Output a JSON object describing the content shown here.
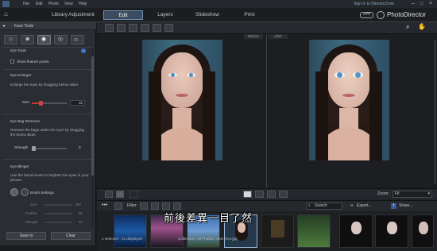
{
  "menu": {
    "file": "File",
    "edit": "Edit",
    "photo": "Photo",
    "view": "View",
    "help": "Help",
    "signin": "Sign in to DirectorZone",
    "window_icons": [
      "minimize-icon",
      "restore-icon",
      "close-icon"
    ]
  },
  "modules": {
    "library": "Library",
    "adjustment": "Adjustment",
    "edit": "Edit",
    "layers": "Layers",
    "slideshow": "Slideshow",
    "print": "Print"
  },
  "brand": {
    "app_badge": "APP",
    "name": "PhotoDirector",
    "accent": "#6d8fb0"
  },
  "panel": {
    "title": "Face Tools",
    "section_eye_tools": "Eye Tools",
    "show_feature_points": "Show feature points",
    "eye_enlarger": {
      "title": "Eye Enlarger",
      "desc": "Enlarge the eyes by dragging below slider.",
      "size_label": "Size",
      "size_value": "25"
    },
    "eye_bag_remover": {
      "title": "Eye Bag Remover",
      "desc": "Remove the bags under the eyes by dragging the below slider.",
      "strength_label": "Strength",
      "strength_value": "0"
    },
    "eye_blinger": {
      "title": "Eye Blinger",
      "desc": "Use the below brush to brighten the eyes in your photos.",
      "brush_settings": "Brush Settings",
      "size_label": "Size",
      "size_value": "350",
      "feather_label": "Feather",
      "feather_value": "35",
      "strength_label": "Strength",
      "strength_value": "25"
    },
    "save_to": "Save to",
    "clear": "Clear"
  },
  "view": {
    "before": "Before",
    "after": "After",
    "zoom_label": "Zoom:",
    "zoom_value": "Fit"
  },
  "filmstrip": {
    "filter_label": "Filter:",
    "search_placeholder": "Search",
    "export": "Export...",
    "share": "Share..."
  },
  "status": {
    "selection": "1 selected - 31 displayed",
    "path": "Collection / All Photos / SkinTone.jpg"
  },
  "subtitle": "前後差異一目了然"
}
